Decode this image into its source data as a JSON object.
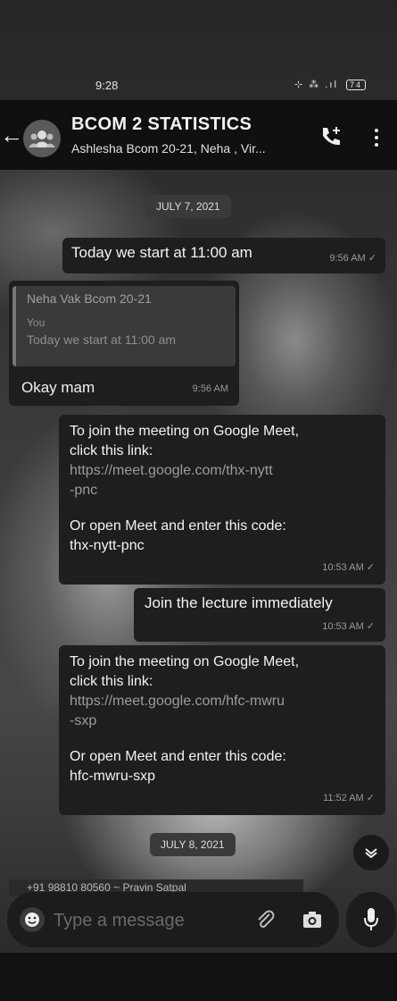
{
  "status_bar": {
    "time": "9:28",
    "icons": "⊹ ⁂ .ıl",
    "battery": "74"
  },
  "header": {
    "title": "BCOM 2 STATISTICS",
    "subtitle": "Ashlesha Bcom 20-21, Neha , Vir..."
  },
  "dates": {
    "first": "JULY 7, 2021",
    "second": "JULY 8, 2021"
  },
  "messages": {
    "m1": {
      "text": "Today we start at 11:00 am",
      "time": "9:56 AM ✓"
    },
    "m2": {
      "quote_name": "Neha Vak Bcom 20-21",
      "quote_label": "You",
      "quote_text": "Today we start at 11:00 am",
      "text": "Okay mam",
      "time": "9:56 AM"
    },
    "m3": {
      "line1": "To join the meeting on Google Meet,",
      "line2": "click this link:",
      "link1": "https://meet.google.com/thx-nytt",
      "link2": "-pnc",
      "line3": "Or open Meet and enter this code:",
      "code": "thx-nytt-pnc",
      "time": "10:53 AM ✓"
    },
    "m4": {
      "text": "Join the lecture immediately",
      "time": "10:53 AM ✓"
    },
    "m5": {
      "line1": "To join the meeting on Google Meet,",
      "line2": "click this link:",
      "link1": "https://meet.google.com/hfc-mwru",
      "link2": "-sxp",
      "line3": "Or open Meet and enter this code:",
      "code": "hfc-mwru-sxp",
      "time": "11:52 AM ✓"
    }
  },
  "partial_message": "+91 98810 80560 ~ Pravin Satpal",
  "composer": {
    "placeholder": "Type a message"
  },
  "icons": {
    "back": "arrow-left",
    "group": "group-avatar",
    "call": "add-call",
    "menu": "more-vert",
    "scroll": "chevron-down",
    "emoji": "emoji",
    "attach": "paperclip",
    "camera": "camera",
    "mic": "microphone"
  }
}
